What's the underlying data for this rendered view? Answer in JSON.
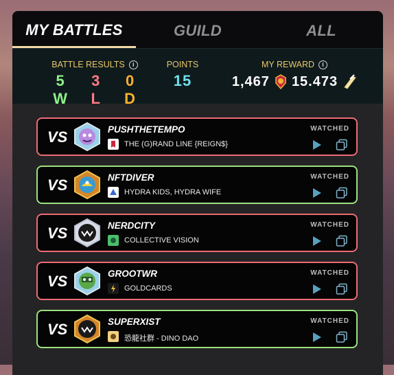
{
  "tabs": [
    {
      "label": "MY BATTLES",
      "active": true
    },
    {
      "label": "GUILD",
      "active": false
    },
    {
      "label": "ALL",
      "active": false
    }
  ],
  "stats": {
    "battle_results_label": "BATTLE RESULTS",
    "wins": "5 W",
    "losses": "3 L",
    "draws": "0 D",
    "points_label": "POINTS",
    "points": "15",
    "reward_label": "MY REWARD",
    "reward_dec": "1,467",
    "reward_sps": "15.473"
  },
  "battles": [
    {
      "vs": "VS",
      "opponent": "PUSHTHETEMPO",
      "guild": "THE (G)RAND LINE {REIGN$}",
      "status": "WATCHED",
      "result": "loss"
    },
    {
      "vs": "VS",
      "opponent": "NFTDIVER",
      "guild": "HYDRA KIDS, HYDRA WIFE",
      "status": "WATCHED",
      "result": "win"
    },
    {
      "vs": "VS",
      "opponent": "NERDCITY",
      "guild": "COLLECTIVE VISION",
      "status": "WATCHED",
      "result": "loss"
    },
    {
      "vs": "VS",
      "opponent": "GROOTWR",
      "guild": "GOLDCARDS",
      "status": "WATCHED",
      "result": "loss"
    },
    {
      "vs": "VS",
      "opponent": "SUPERXIST",
      "guild": "恐龍社群 - DINO DAO",
      "status": "WATCHED",
      "result": "win"
    }
  ],
  "colors": {
    "win_border": "#9ce27f",
    "loss_border": "#ee6b75",
    "accent_gold": "#e8c86a",
    "points_cyan": "#6fe0ec"
  },
  "icons": [
    "info-icon",
    "dec-icon",
    "sps-icon",
    "play-icon",
    "copy-icon",
    "guild-icon",
    "avatar"
  ]
}
